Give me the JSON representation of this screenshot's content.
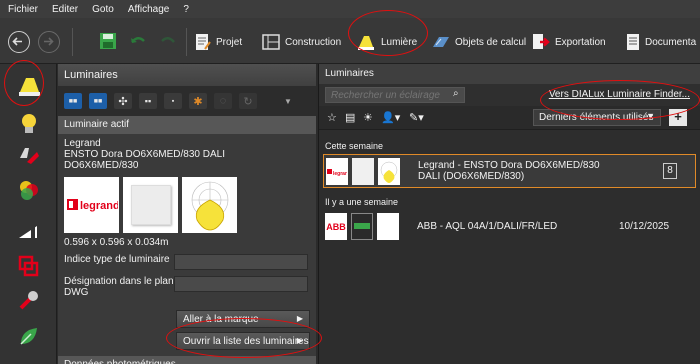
{
  "menubar": {
    "items": [
      "Fichier",
      "Editer",
      "Goto",
      "Affichage",
      "?"
    ]
  },
  "toolbar": {
    "projet": "Projet",
    "construction": "Construction",
    "lumiere": "Lumière",
    "objets": "Objets de calcul",
    "exportation": "Exportation",
    "documentation": "Documenta"
  },
  "luminaires": {
    "title": "Luminaires",
    "actif_header": "Luminaire actif",
    "manufacturer": "Legrand",
    "model_line1": "ENSTO Dora DO6X6MED/830 DALI",
    "model_line2": "DO6X6MED/830",
    "dimensions": "0.596 x 0.596 x 0.034m",
    "indice_label": "Indice type de luminaire",
    "designation_label": "Désignation dans le plan DWG",
    "btn_aller": "Aller à la marque",
    "btn_ouvrir": "Ouvrir la liste des luminaires",
    "footer": "Données photométriques"
  },
  "catalog": {
    "title": "Luminaires",
    "search_placeholder": "Rechercher un éclairage",
    "finder_link": "Vers DIALux Luminaire Finder...",
    "recent_label": "Derniers éléments utilisés",
    "group1": "Cette semaine",
    "item1_line1": "Legrand  -  ENSTO Dora DO6X6MED/830",
    "item1_line2": "DALI (DO6X6MED/830)",
    "item1_count": "8",
    "group2": "Il y a une semaine",
    "item2_title": "ABB  -  AQL 04A/1/DALI/FR/LED",
    "item2_date": "10/12/2025"
  },
  "colors": {
    "accent_orange": "#e08a28",
    "annotation_red": "#e01010",
    "legrand_red": "#e2001a"
  }
}
